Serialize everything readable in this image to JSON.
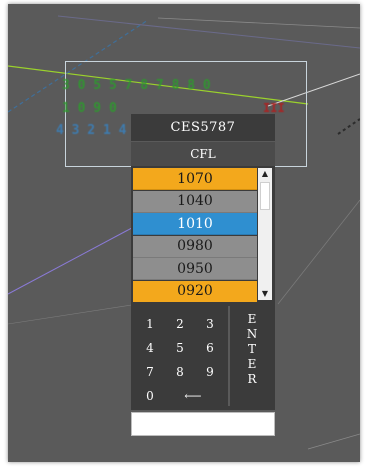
{
  "radar_label": {
    "line1": "3 0 5 5 7 8 7  8 8 0",
    "line2": "1 0 9 0",
    "line3": "4 3 2 1 4 5",
    "mark": "III"
  },
  "panel": {
    "callsign": "CES5787",
    "field_label": "CFL"
  },
  "levels": [
    {
      "value": "1070",
      "state": "highlight"
    },
    {
      "value": "1040",
      "state": "normal"
    },
    {
      "value": "1010",
      "state": "selected"
    },
    {
      "value": "0980",
      "state": "normal"
    },
    {
      "value": "0950",
      "state": "normal"
    },
    {
      "value": "0920",
      "state": "highlight"
    }
  ],
  "scroll": {
    "up_icon": "▲",
    "down_icon": "▼"
  },
  "keypad": {
    "k1": "1",
    "k2": "2",
    "k3": "3",
    "k4": "4",
    "k5": "5",
    "k6": "6",
    "k7": "7",
    "k8": "8",
    "k9": "9",
    "k0": "0",
    "backspace": "⟵",
    "enter_letters": [
      "E",
      "N",
      "T",
      "E",
      "R"
    ]
  },
  "input": {
    "value": "",
    "placeholder": ""
  },
  "colors": {
    "background": "#5a5a5a",
    "panel_dark": "#3b3b3b",
    "highlight_orange": "#f3a81c",
    "selected_blue": "#2f8fd0",
    "label_green": "#2e9a2e",
    "label_blue": "#3b7fb8"
  }
}
